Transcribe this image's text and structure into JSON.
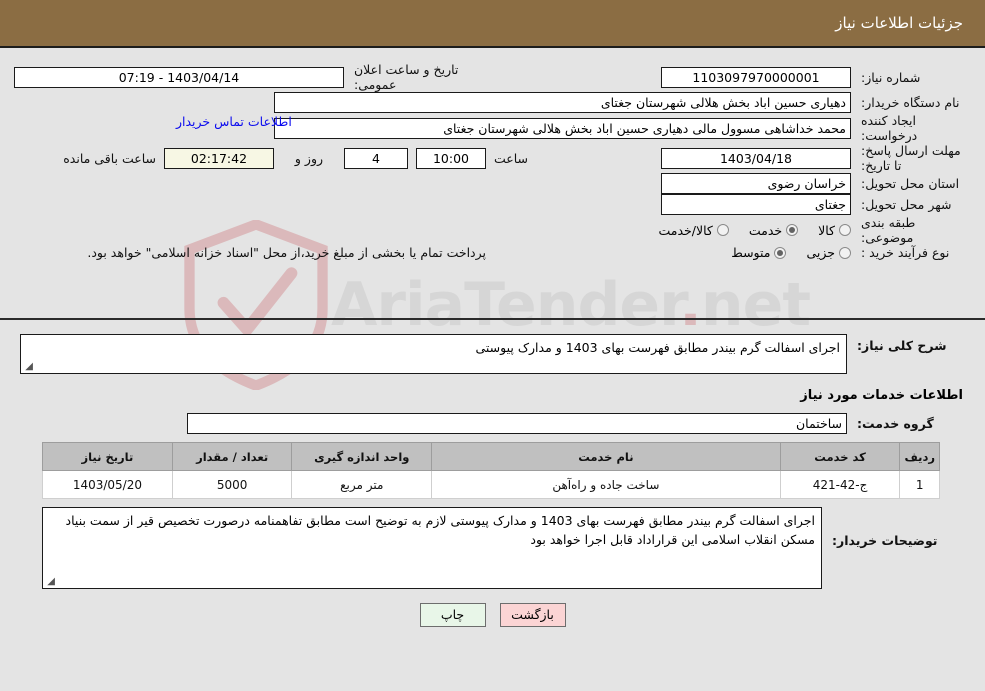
{
  "header": {
    "title": "جزئیات اطلاعات نیاز"
  },
  "top_form": {
    "need_number_label": "شماره نیاز:",
    "need_number_value": "1103097970000001",
    "public_announce_label": "تاریخ و ساعت اعلان عمومی:",
    "public_announce_value": "1403/04/14 - 07:19",
    "buyer_org_label": "نام دستگاه خریدار:",
    "buyer_org_value": "دهیاری حسین اباد بخش هلالی شهرستان جغتای",
    "requester_label": "ایجاد کننده درخواست:",
    "requester_value": "محمد خداشاهی مسوول مالی دهیاری حسین اباد بخش هلالی شهرستان جغتای",
    "contact_link": "اطلاعات تماس خریدار",
    "deadline_label": "مهلت ارسال پاسخ: تا تاریخ:",
    "deadline_date": "1403/04/18",
    "hour_label": "ساعت",
    "hour_value": "10:00",
    "days_value": "4",
    "days_label": "روز و",
    "timer_value": "02:17:42",
    "timer_suffix": "ساعت باقی مانده",
    "province_label": "استان محل تحویل:",
    "province_value": "خراسان رضوی",
    "city_label": "شهر محل تحویل:",
    "city_value": "جغتای",
    "category_label": "طبقه بندی موضوعی:",
    "category_options": [
      {
        "label": "کالا",
        "selected": false
      },
      {
        "label": "خدمت",
        "selected": true
      },
      {
        "label": "کالا/خدمت",
        "selected": false
      }
    ],
    "process_label": "نوع فرآیند خرید :",
    "process_options": [
      {
        "label": "جزیی",
        "selected": false
      },
      {
        "label": "متوسط",
        "selected": true
      }
    ],
    "treasury_note": "پرداخت تمام یا بخشی از مبلغ خرید،از محل \"اسناد خزانه اسلامی\" خواهد بود."
  },
  "middle": {
    "general_desc_label": "شرح کلی نیاز:",
    "general_desc_value": "اجرای اسفالت گرم بیندر مطابق فهرست بهای 1403 و مدارک پیوستی",
    "services_heading": "اطلاعات خدمات مورد نیاز",
    "service_group_label": "گروه خدمت:",
    "service_group_value": "ساختمان"
  },
  "table": {
    "columns": [
      "ردیف",
      "کد خدمت",
      "نام خدمت",
      "واحد اندازه گیری",
      "تعداد / مقدار",
      "تاریخ نیاز"
    ],
    "rows": [
      {
        "index": "1",
        "code": "ج-42-421",
        "name": "ساخت جاده و راه‌آهن",
        "unit": "متر مربع",
        "quantity": "5000",
        "date": "1403/05/20"
      }
    ]
  },
  "notes": {
    "label": "توضیحات خریدار:",
    "value": "اجرای اسفالت گرم بیندر مطابق فهرست بهای 1403 و مدارک پیوستی لازم به توضیح است مطابق تفاهمنامه درصورت تخصیص قیر از سمت بنیاد مسکن انقلاب اسلامی این قراراداد قابل اجرا خواهد بود"
  },
  "footer": {
    "print_label": "چاپ",
    "back_label": "بازگشت"
  },
  "watermark": {
    "text_a": "AriaTender",
    "text_dot": ".",
    "text_b": "net"
  }
}
